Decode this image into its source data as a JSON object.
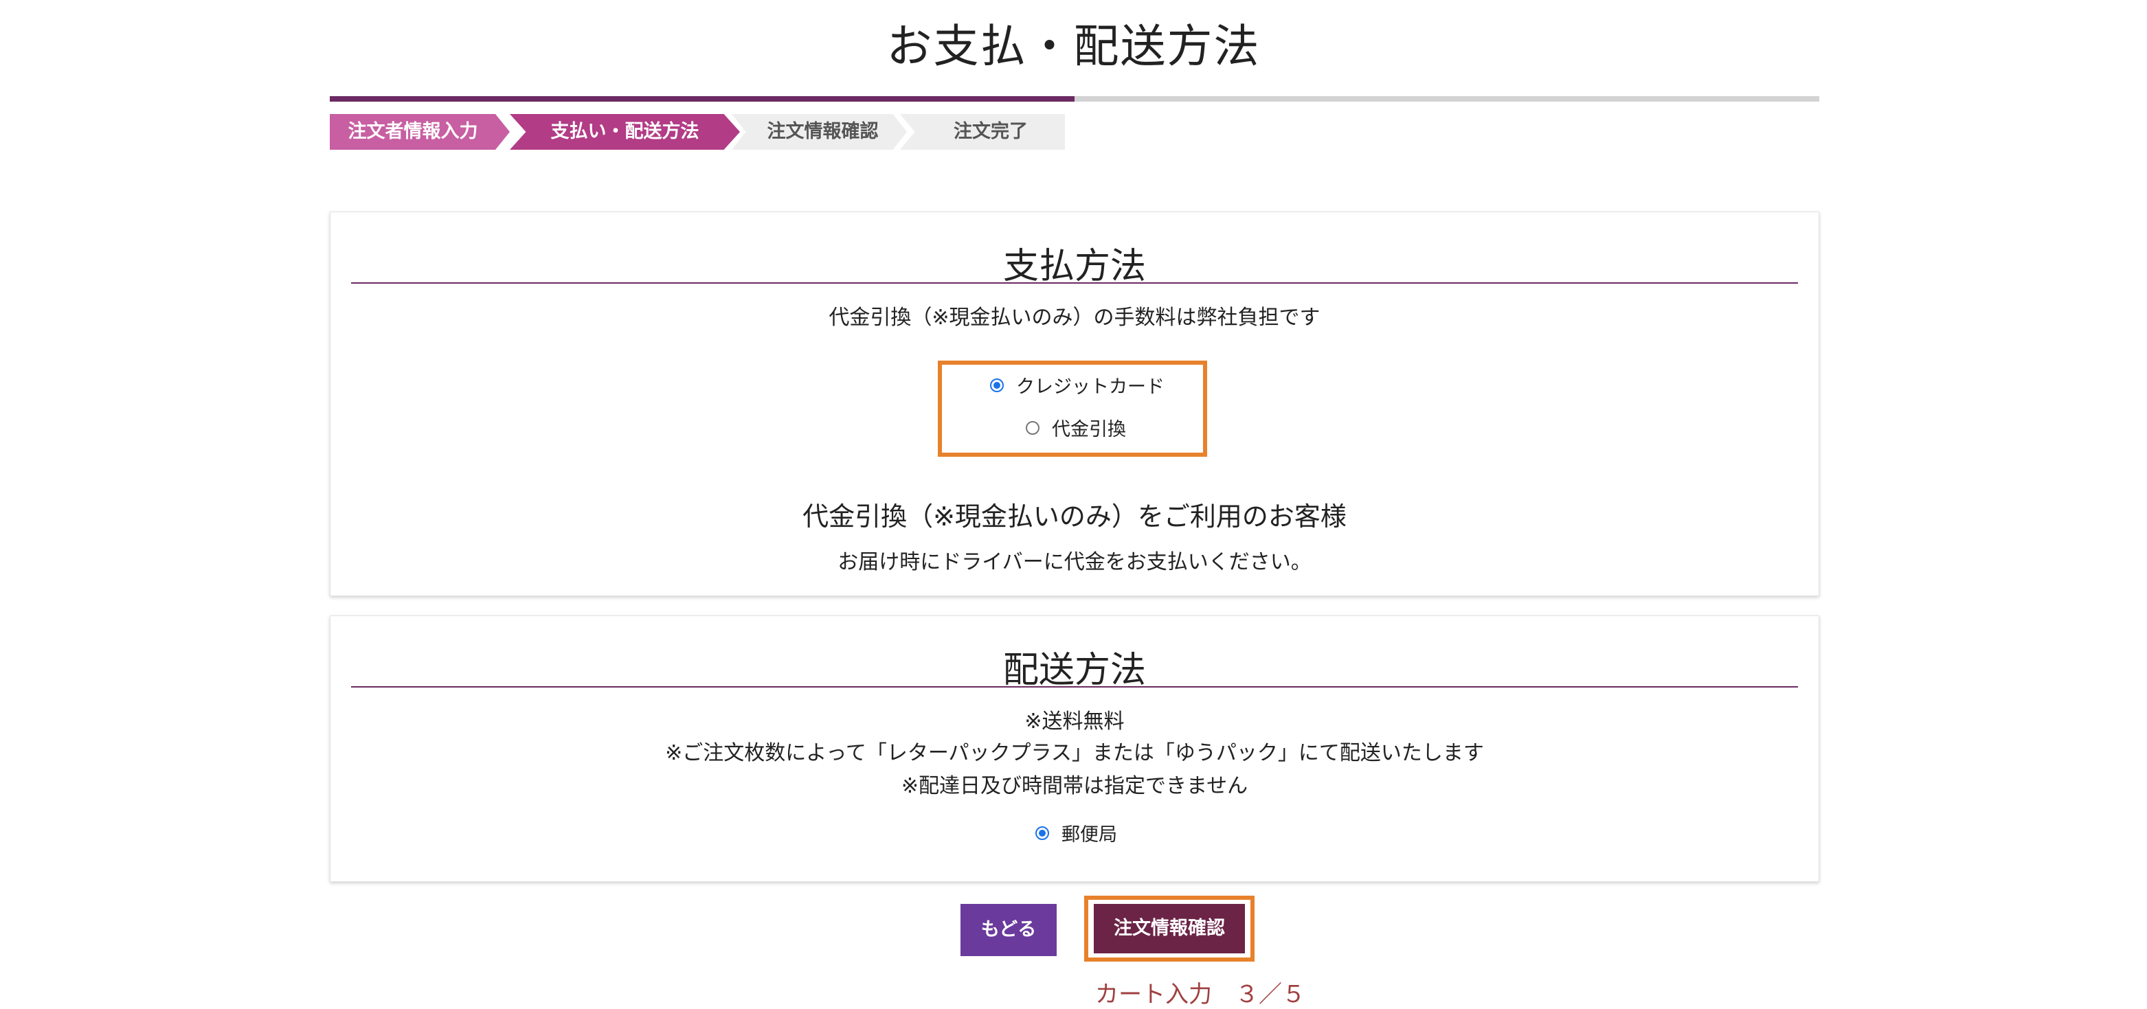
{
  "page": {
    "title": "お支払・配送方法"
  },
  "progress": {
    "percent": 50
  },
  "steps": [
    {
      "label": "注文者情報入力",
      "state": "done"
    },
    {
      "label": "支払い・配送方法",
      "state": "current"
    },
    {
      "label": "注文情報確認",
      "state": "upcoming"
    },
    {
      "label": "注文完了",
      "state": "upcoming"
    }
  ],
  "payment": {
    "heading": "支払方法",
    "note": "代金引換（※現金払いのみ）の手数料は弊社負担です",
    "options": [
      {
        "label": "クレジットカード",
        "selected": true
      },
      {
        "label": "代金引換",
        "selected": false
      }
    ],
    "cod_heading": "代金引換（※現金払いのみ）をご利用のお客様",
    "cod_text": "お届け時にドライバーに代金をお支払いください。"
  },
  "shipping": {
    "heading": "配送方法",
    "lines": [
      "※送料無料",
      "※ご注文枚数によって「レターパックプラス」または「ゆうパック」にて配送いたします",
      "※配達日及び時間帯は指定できません"
    ],
    "options": [
      {
        "label": "郵便局",
        "selected": true
      }
    ]
  },
  "buttons": {
    "back": "もどる",
    "confirm": "注文情報確認"
  },
  "footer": {
    "text": "カート入力　３／５"
  },
  "colors": {
    "accent_purple": "#6b2a63",
    "step_done": "#c75fa2",
    "step_current": "#b23c86",
    "highlight_orange": "#e8812b",
    "back_button": "#6a3a9c",
    "confirm_button": "#6b2346"
  }
}
